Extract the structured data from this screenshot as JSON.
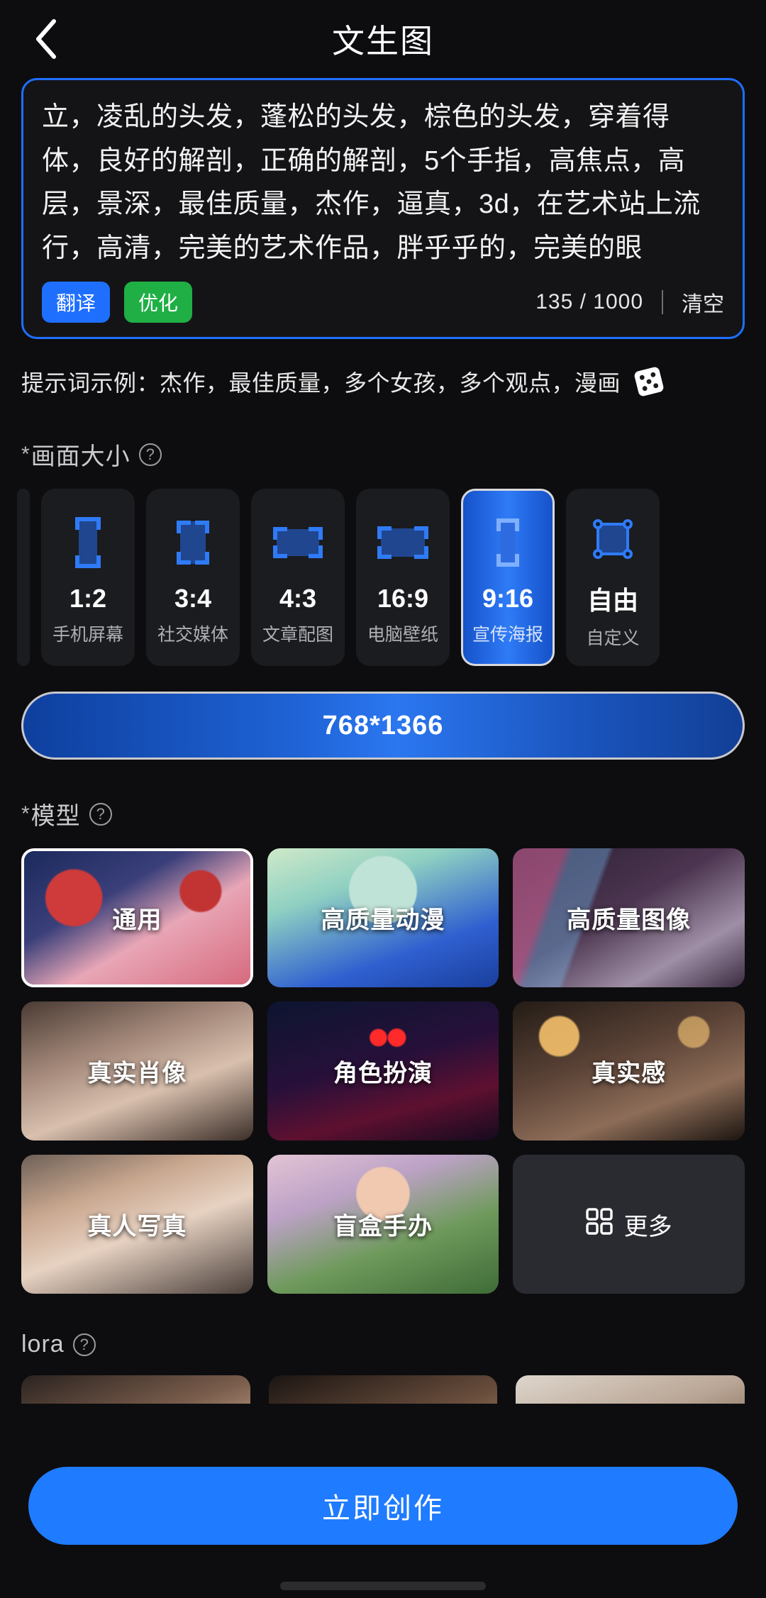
{
  "header": {
    "back_icon": "chevron-left-icon",
    "title": "文生图"
  },
  "prompt": {
    "text": "立，凌乱的头发，蓬松的头发，棕色的头发，穿着得体，良好的解剖，正确的解剖，5个手指，高焦点，高层，景深，最佳质量，杰作，逼真，3d，在艺术站上流行，高清，完美的艺术作品，胖乎乎的，完美的眼",
    "translate_label": "翻译",
    "optimize_label": "优化",
    "counter": "135 / 1000",
    "clear_label": "清空",
    "translate_color": "#1f6fff",
    "optimize_color": "#1faf45",
    "border_color": "#1f6fff"
  },
  "hint": {
    "text": "提示词示例：杰作，最佳质量，多个女孩，多个观点，漫画",
    "dice_icon": "dice-icon"
  },
  "size_section": {
    "required_mark": "*",
    "label": "画面大小",
    "help_icon": "question-mark-icon",
    "options": [
      {
        "ratio": "1:2",
        "desc": "手机屏幕",
        "glyph": "frame-portrait-tall",
        "selected": false
      },
      {
        "ratio": "3:4",
        "desc": "社交媒体",
        "glyph": "frame-portrait",
        "selected": false
      },
      {
        "ratio": "4:3",
        "desc": "文章配图",
        "glyph": "frame-landscape",
        "selected": false
      },
      {
        "ratio": "16:9",
        "desc": "电脑壁纸",
        "glyph": "frame-wide",
        "selected": false
      },
      {
        "ratio": "9:16",
        "desc": "宣传海报",
        "glyph": "frame-portrait-tall",
        "selected": true
      },
      {
        "ratio": "自由",
        "desc": "自定义",
        "glyph": "frame-handles",
        "selected": false
      }
    ],
    "resolution": "768*1366"
  },
  "model_section": {
    "required_mark": "*",
    "label": "模型",
    "help_icon": "question-mark-icon",
    "items": [
      {
        "label": "通用",
        "thumb": "t1",
        "selected": true
      },
      {
        "label": "高质量动漫",
        "thumb": "t2",
        "selected": false
      },
      {
        "label": "高质量图像",
        "thumb": "t3",
        "selected": false
      },
      {
        "label": "真实肖像",
        "thumb": "t4",
        "selected": false
      },
      {
        "label": "角色扮演",
        "thumb": "t5",
        "selected": false
      },
      {
        "label": "真实感",
        "thumb": "t6",
        "selected": false
      },
      {
        "label": "真人写真",
        "thumb": "t7",
        "selected": false
      },
      {
        "label": "盲盒手办",
        "thumb": "t8",
        "selected": false
      }
    ],
    "more": {
      "label": "更多",
      "icon": "grid-icon"
    }
  },
  "lora_section": {
    "label": "lora",
    "help_icon": "question-mark-icon",
    "items": [
      {
        "thumb": "t9"
      },
      {
        "thumb": "t10"
      },
      {
        "thumb": "t11"
      }
    ]
  },
  "bottom": {
    "create_label": "立即创作",
    "create_color": "#1f7bff"
  }
}
